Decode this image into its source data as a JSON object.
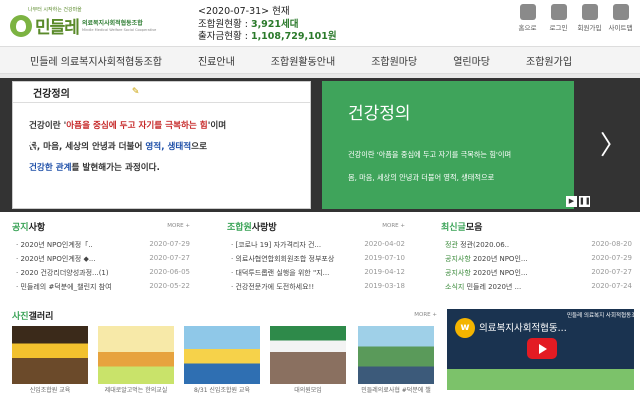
{
  "logo": {
    "tagline": "나부터 시작하는 건강마을",
    "name": "민들레",
    "org": "의료복지사회적협동조합",
    "eng": "Mindle Medical Welfare Social Cooperative"
  },
  "stats": {
    "date_line": "<2020-07-31> 현재",
    "members_label": "조합원현황 :",
    "members_value": "3,921세대",
    "capital_label": "출자금현황 :",
    "capital_value": "1,108,729,101원"
  },
  "util": [
    "홈으로",
    "로그인",
    "회원가입",
    "사이트맵"
  ],
  "nav": [
    "민들레 의료복지사회적협동조합",
    "진료안내",
    "조합원활동안내",
    "조합원마당",
    "열린마당",
    "조합원가입"
  ],
  "banner": {
    "card_title": "건강정의",
    "line1_a": "건강이란 '",
    "line1_red": "아픔을 중심에 두고 자기를 극복하는 힘",
    "line1_b": "'이며",
    "line2_a": "몸, 마음, 세상의 안녕과 더불어 ",
    "line2_blue": "영적, 생태적",
    "line2_b": "으로",
    "line3_blue": "건강한 관계",
    "line3_b": "를 발현해가는 과정이다.",
    "green_title": "건강정의",
    "green_line1": "건강이란 '아픔을 중심에 두고 자기를 극복하는 힘'이며",
    "green_line2": "몸, 마음, 세상의 안녕과 더불어 영적, 생태적으로",
    "prev": "〈",
    "next": "〉"
  },
  "panels": {
    "more": "MORE +",
    "notice": {
      "title_acc": "공지",
      "title_rest": "사항",
      "items": [
        {
          "title": "2020년 NPO인계정「..",
          "date": "2020-07-29"
        },
        {
          "title": "2020년 NPO인계정 ◆...",
          "date": "2020-07-27"
        },
        {
          "title": "2020 건강리더양성과정...(1)",
          "date": "2020-06-05"
        },
        {
          "title": "민들레의 #덕분에_챌린지 참여",
          "date": "2020-05-22"
        }
      ]
    },
    "members": {
      "title_acc": "조합원",
      "title_rest": "사랑방",
      "items": [
        {
          "title": "[코로나 19] 자가격리자 건...",
          "date": "2020-04-02"
        },
        {
          "title": "의료사협연합회회원조합 정부포상",
          "date": "2019-07-10"
        },
        {
          "title": "대덕투드롭랜 실행을 위한 \"지...",
          "date": "2019-04-12"
        },
        {
          "title": "건강전문가에 도전하세요!!",
          "date": "2019-03-18"
        }
      ]
    },
    "latest": {
      "title_acc": "최신글",
      "title_rest": "모음",
      "items": [
        {
          "cat": "정관",
          "title": "정관(2020.06..",
          "date": "2020-08-20"
        },
        {
          "cat": "공지사항",
          "title": "2020년 NPO인...",
          "date": "2020-07-29"
        },
        {
          "cat": "공지사항",
          "title": "2020년 NPO인...",
          "date": "2020-07-27"
        },
        {
          "cat": "소식지",
          "title": "민들레 2020년 ...",
          "date": "2020-07-24"
        }
      ]
    }
  },
  "gallery": {
    "title_acc": "사진",
    "title_rest": "갤러리",
    "captions": [
      "신입조합원 교육",
      "제대로알고먹는 한의교실",
      "8/31 신입조합원 교육",
      "대의원모임",
      "민들레의료사협 #덕분에 챌"
    ],
    "video_title": "의료복지사회적협동...",
    "video_sub": "민들레 의료복지 사회적협동조합",
    "video_logo": "w"
  },
  "colors": {
    "accent": "#3aa357",
    "banner_green": "#3fa45b",
    "alert_red": "#c62828"
  }
}
